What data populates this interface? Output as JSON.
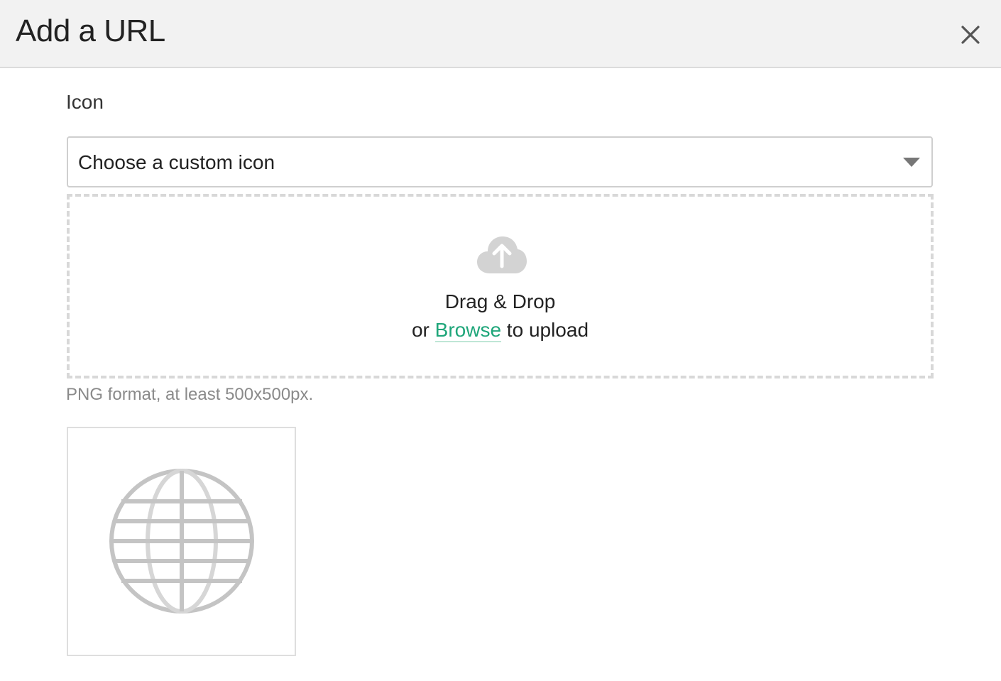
{
  "dialog": {
    "title": "Add a URL",
    "close_icon": "close-icon"
  },
  "icon_field": {
    "label": "Icon",
    "select": {
      "selected": "Choose a custom icon",
      "caret_icon": "caret-down-icon"
    },
    "dropzone": {
      "icon": "cloud-upload-icon",
      "line1": "Drag & Drop",
      "line2_prefix": "or ",
      "browse_label": "Browse",
      "line2_suffix": " to upload"
    },
    "help_text": "PNG format, at least 500x500px.",
    "preview": {
      "icon": "globe-icon"
    }
  },
  "colors": {
    "header_bg": "#f2f2f2",
    "accent": "#1fa67a",
    "muted_text": "#8a8a8a",
    "icon_gray": "#c4c4c4"
  }
}
